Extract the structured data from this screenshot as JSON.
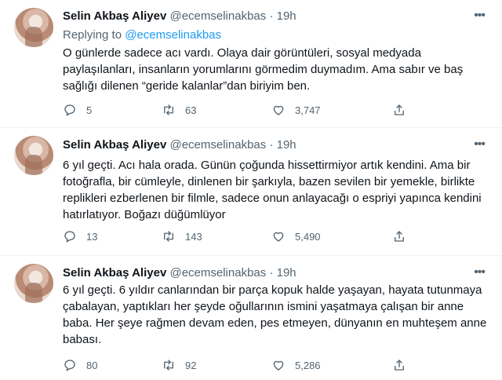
{
  "tweets": [
    {
      "name": "Selin Akbaş Aliyev",
      "handle": "@ecemselinakbas",
      "dot": "·",
      "time": "19h",
      "replying_prefix": "Replying to",
      "replying_mention": "@ecemselinakbas",
      "text": "O günlerde sadece acı vardı. Olaya dair görüntüleri, sosyal medyada paylaşılanları, insanların yorumlarını görmedim duymadım. Ama sabır ve baş sağlığı dilenen “geride kalanlar”dan biriyim ben.",
      "replies": "5",
      "retweets": "63",
      "likes": "3,747"
    },
    {
      "name": "Selin Akbaş Aliyev",
      "handle": "@ecemselinakbas",
      "dot": "·",
      "time": "19h",
      "text": "6 yıl geçti. Acı hala orada. Günün çoğunda hissettirmiyor artık kendini. Ama bir fotoğrafla, bir cümleyle, dinlenen bir şarkıyla, bazen sevilen bir yemekle, birlikte replikleri ezberlenen bir filmle, sadece onun anlayacağı o espriyi yapınca kendini hatırlatıyor. Boğazı düğümlüyor",
      "replies": "13",
      "retweets": "143",
      "likes": "5,490"
    },
    {
      "name": "Selin Akbaş Aliyev",
      "handle": "@ecemselinakbas",
      "dot": "·",
      "time": "19h",
      "text": "6 yıl geçti. 6 yıldır canlarından bir parça kopuk halde yaşayan, hayata tutunmaya çabalayan, yaptıkları her şeyde oğullarının ismini yaşatmaya çalışan bir anne baba. Her şeye rağmen devam eden, pes etmeyen, dünyanın en muhteşem anne babası.",
      "replies": "80",
      "retweets": "92",
      "likes": "5,286"
    }
  ],
  "icons": {
    "reply": "reply-icon",
    "retweet": "retweet-icon",
    "like": "heart-icon",
    "share": "share-icon",
    "more": "more-icon"
  },
  "colors": {
    "accent": "#1d9bf0",
    "secondary_text": "#536471",
    "primary_text": "#0f1419",
    "divider": "#eff3f4"
  }
}
